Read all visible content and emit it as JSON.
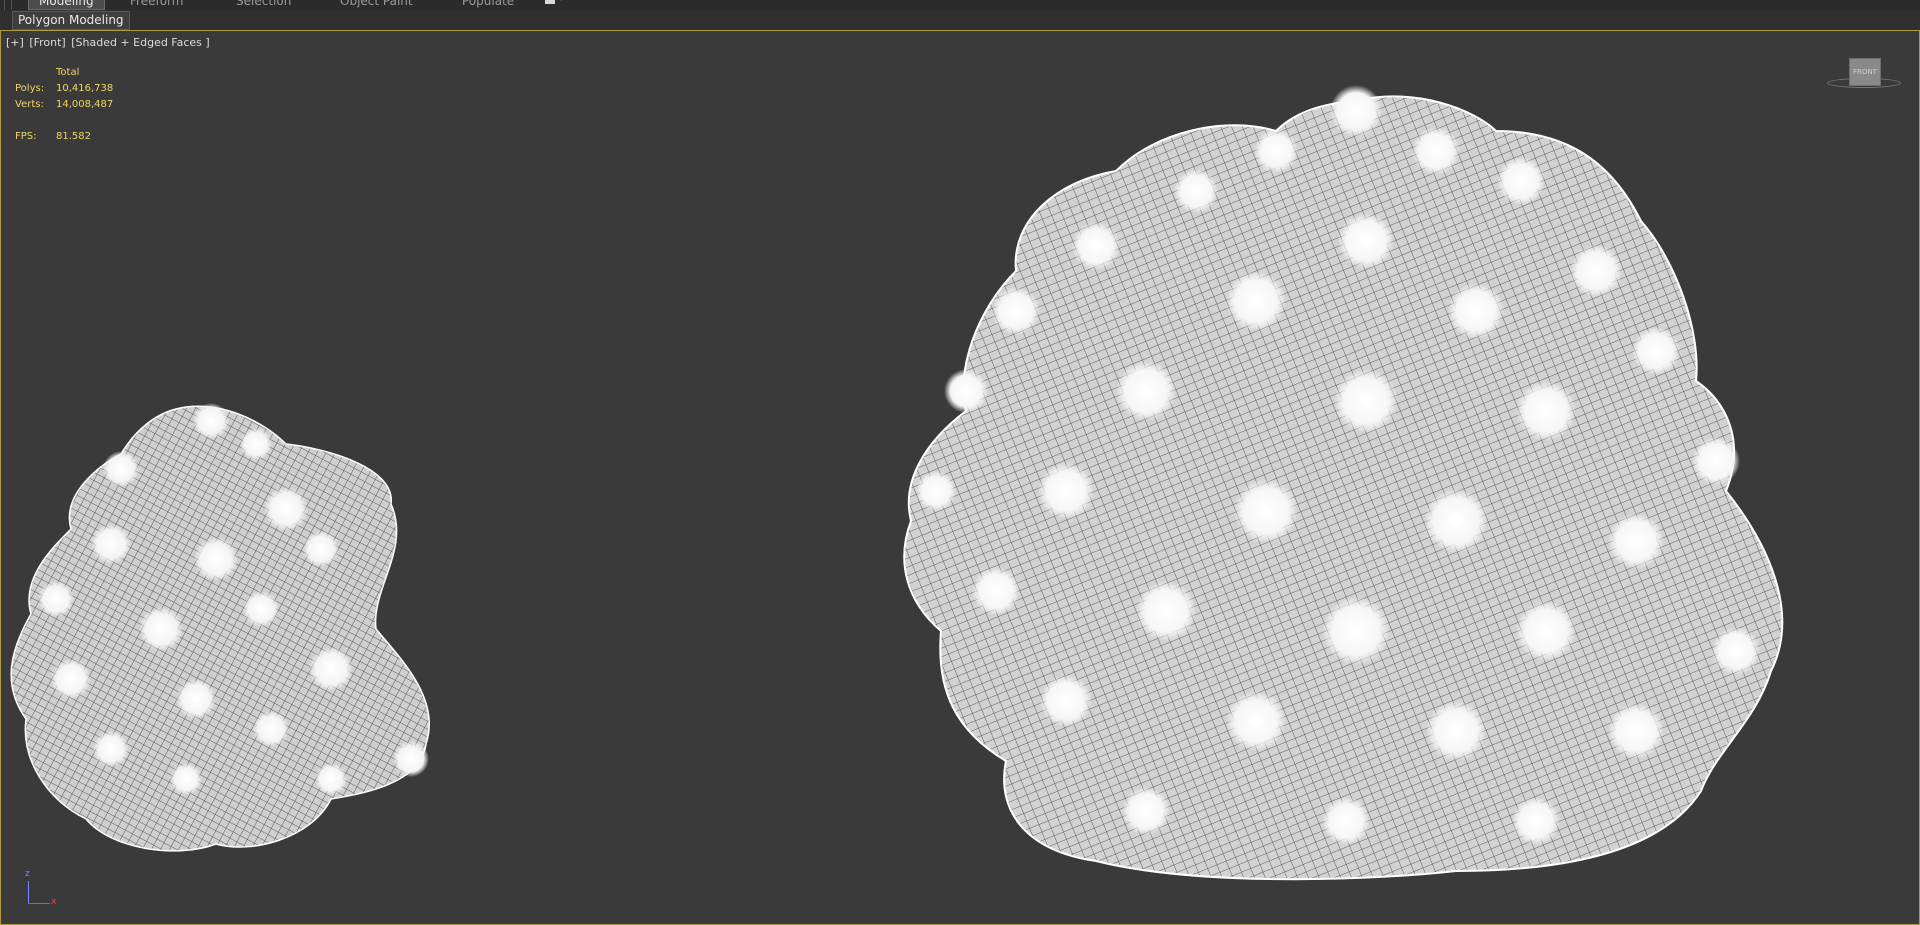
{
  "ribbon": {
    "tabs": [
      "Modeling",
      "Freeform",
      "Selection",
      "Object Paint",
      "Populate"
    ],
    "active_tab": "Modeling"
  },
  "panel": {
    "label": "Polygon Modeling"
  },
  "viewport": {
    "label_menu": "[+]",
    "label_view": "[Front]",
    "label_shading": "[Shaded + Edged Faces ]",
    "stats": {
      "header": "Total",
      "polys_label": "Polys:",
      "polys_value": "10,416,738",
      "verts_label": "Verts:",
      "verts_value": "14,008,487",
      "fps_label": "FPS:",
      "fps_value": "81.582"
    },
    "viewcube_label": "FRONT",
    "axis": {
      "z": "z",
      "x": "x"
    }
  },
  "colors": {
    "viewport_bg": "#3a3a3a",
    "active_border": "#b09a3a",
    "stats_text": "#f0d565",
    "mesh": "#ffffff"
  }
}
